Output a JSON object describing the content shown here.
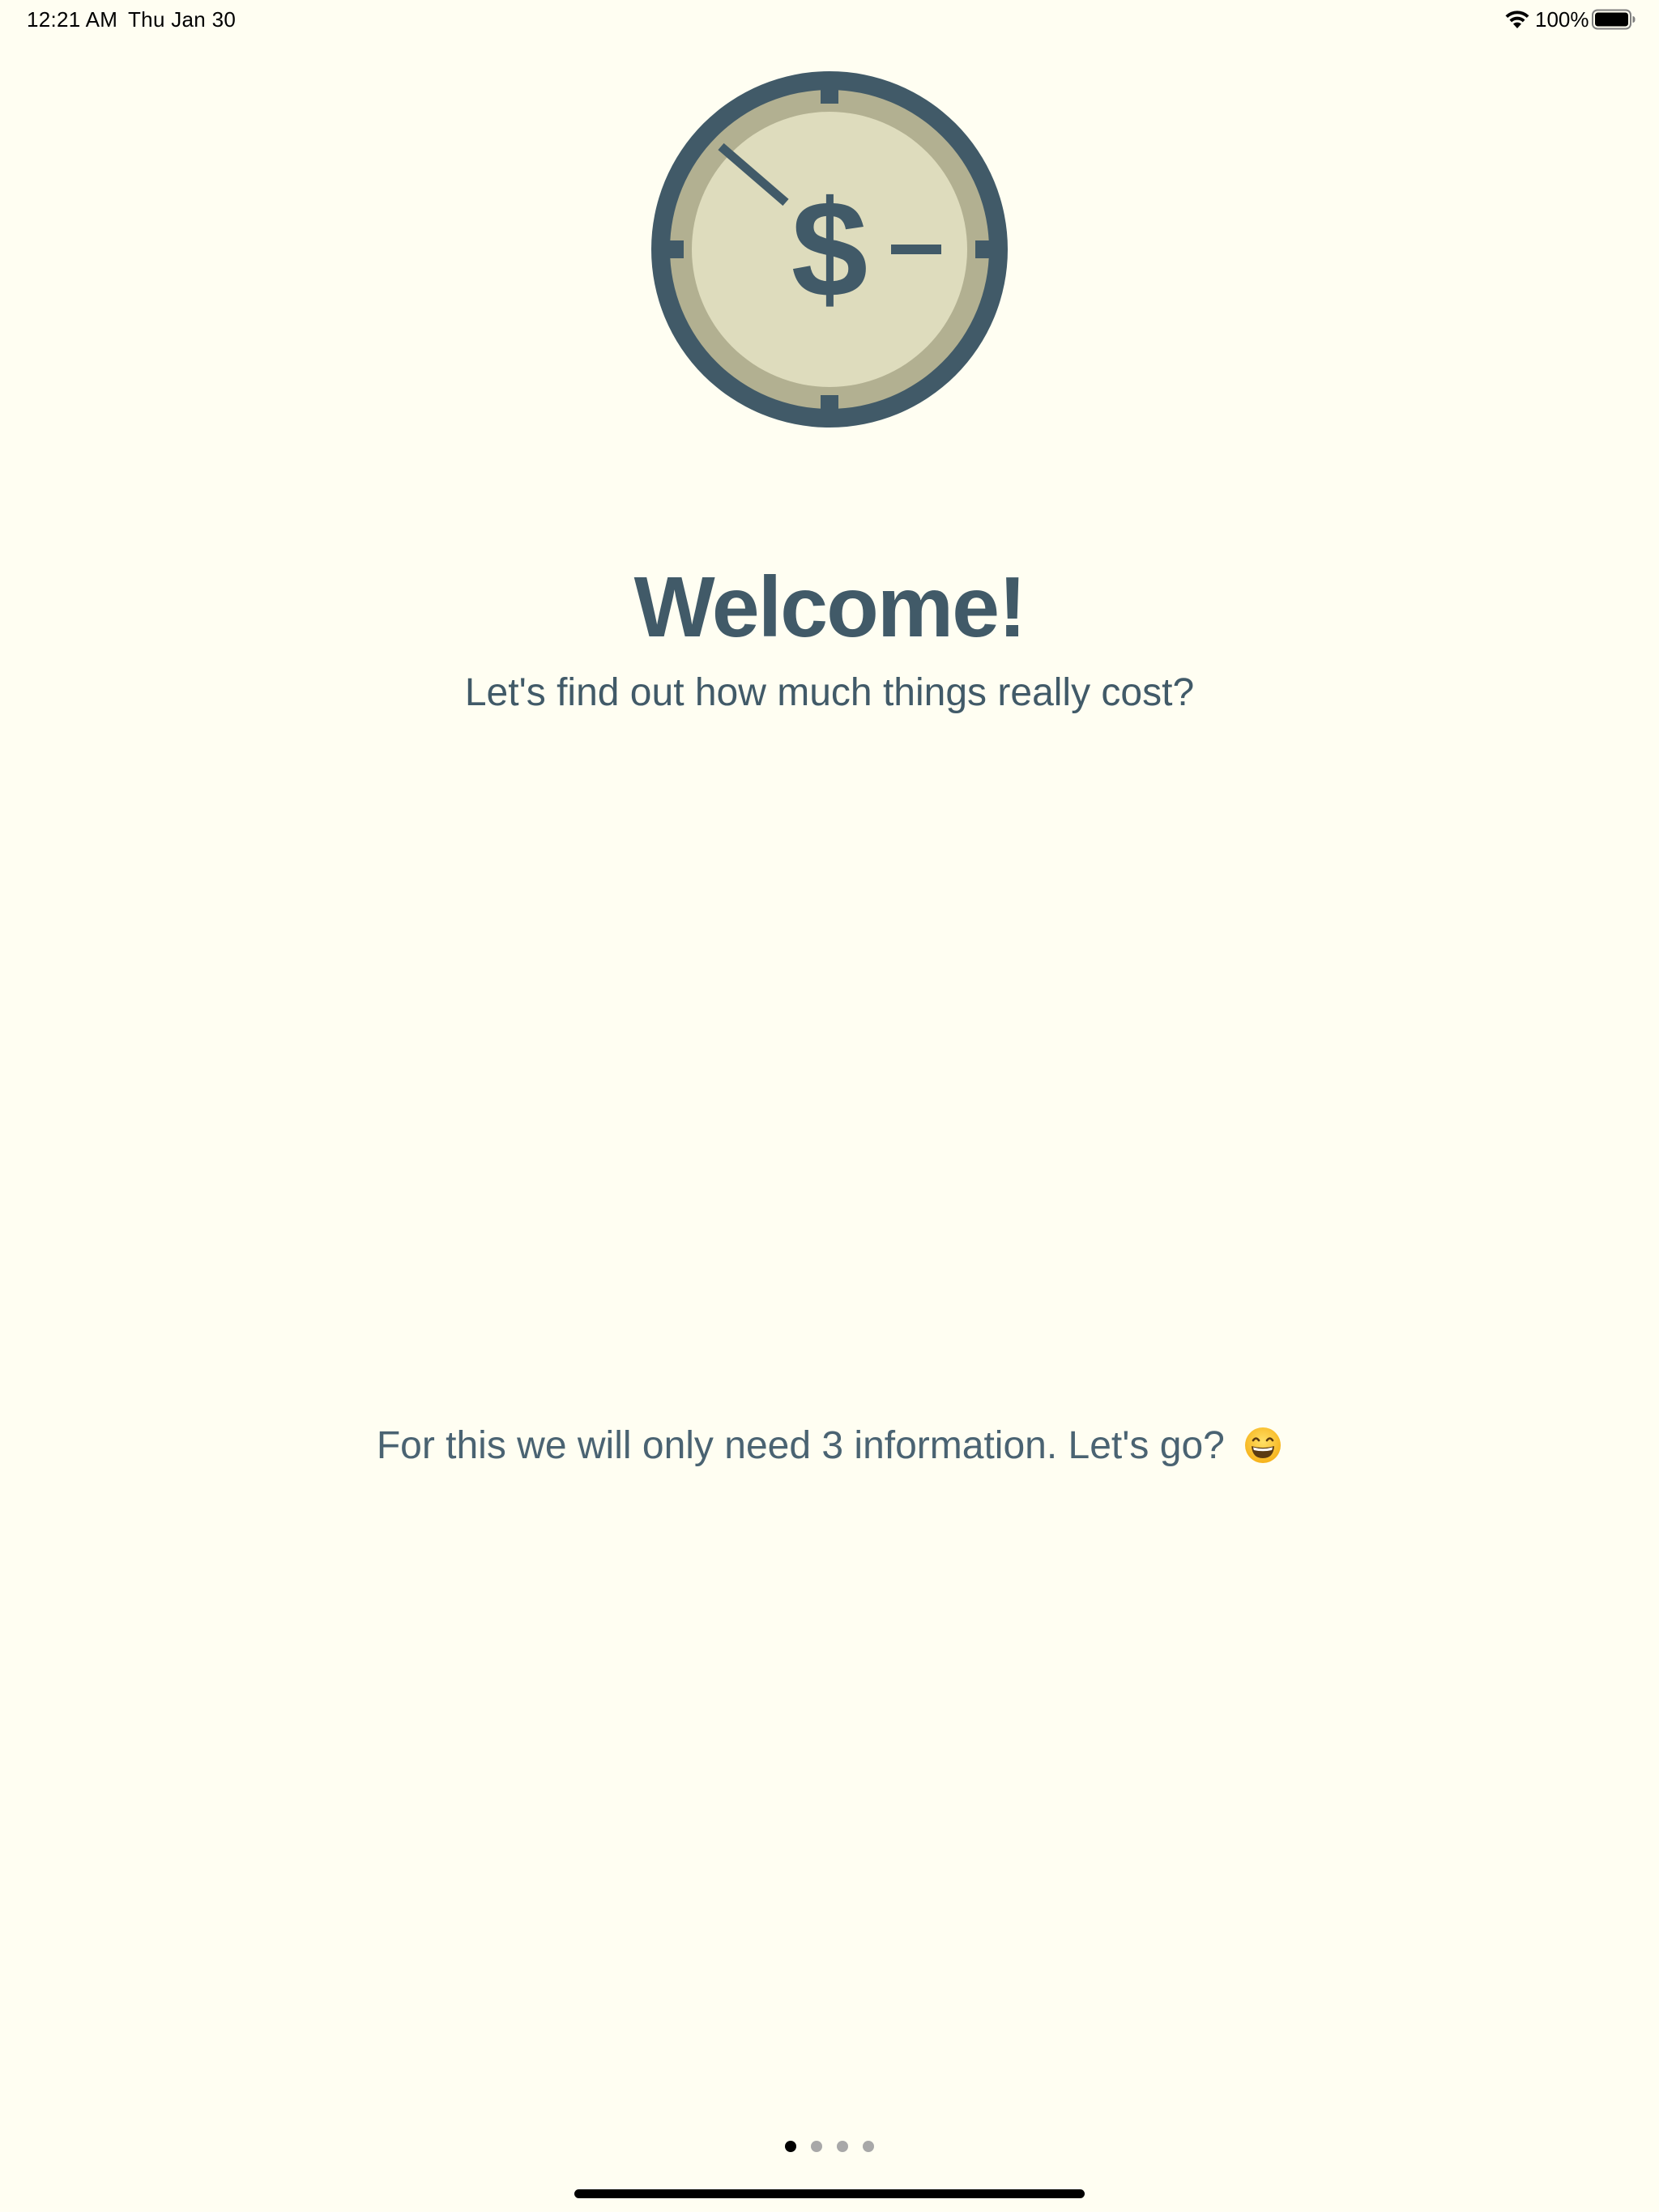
{
  "status_bar": {
    "time": "12:21 AM",
    "date": "Thu Jan 30",
    "battery_percent": "100%",
    "battery_level": 1.0,
    "icons": [
      "wifi-icon",
      "battery-icon"
    ]
  },
  "logo": {
    "symbol": "$",
    "icon": "coin-clock-dollar-icon",
    "colors": {
      "outer_ring": "#415A68",
      "inner_ring": "#B2B091",
      "face": "#DEDCBD",
      "ink": "#415A68"
    }
  },
  "welcome": {
    "title": "Welcome!",
    "subtitle": "Let's find out how much things really cost?",
    "info": "For this we will only need 3 information. Let's go?",
    "info_emoji": "grinning-face-icon"
  },
  "pager": {
    "page_count": 4,
    "current_page": 1
  },
  "colors": {
    "background": "#FFFEF2",
    "text": "#415A68",
    "dot_active": "#000000",
    "dot_inactive": "#A8A8A8"
  }
}
